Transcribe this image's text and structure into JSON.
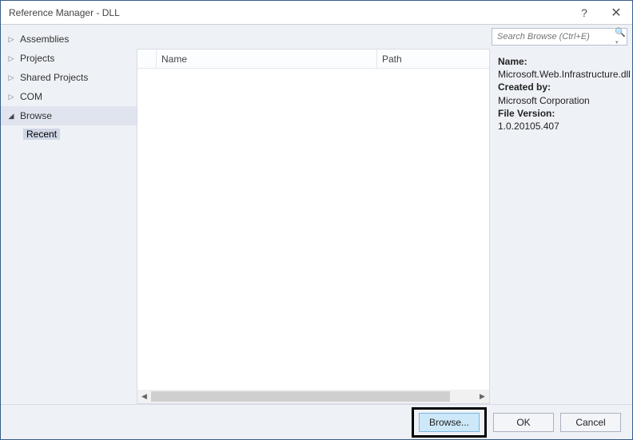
{
  "title": "Reference Manager - DLL",
  "sidebar": {
    "items": [
      {
        "label": "Assemblies",
        "expanded": false
      },
      {
        "label": "Projects",
        "expanded": false
      },
      {
        "label": "Shared Projects",
        "expanded": false
      },
      {
        "label": "COM",
        "expanded": false
      },
      {
        "label": "Browse",
        "expanded": true,
        "children": [
          {
            "label": "Recent",
            "selected": true
          }
        ]
      }
    ]
  },
  "search": {
    "placeholder": "Search Browse (Ctrl+E)"
  },
  "list": {
    "columns": {
      "name": "Name",
      "path": "Path"
    },
    "rows": []
  },
  "details": {
    "name_label": "Name:",
    "name_value": "Microsoft.Web.Infrastructure.dll",
    "created_label": "Created by:",
    "created_value": "Microsoft Corporation",
    "version_label": "File Version:",
    "version_value": "1.0.20105.407"
  },
  "footer": {
    "browse": "Browse...",
    "ok": "OK",
    "cancel": "Cancel"
  }
}
